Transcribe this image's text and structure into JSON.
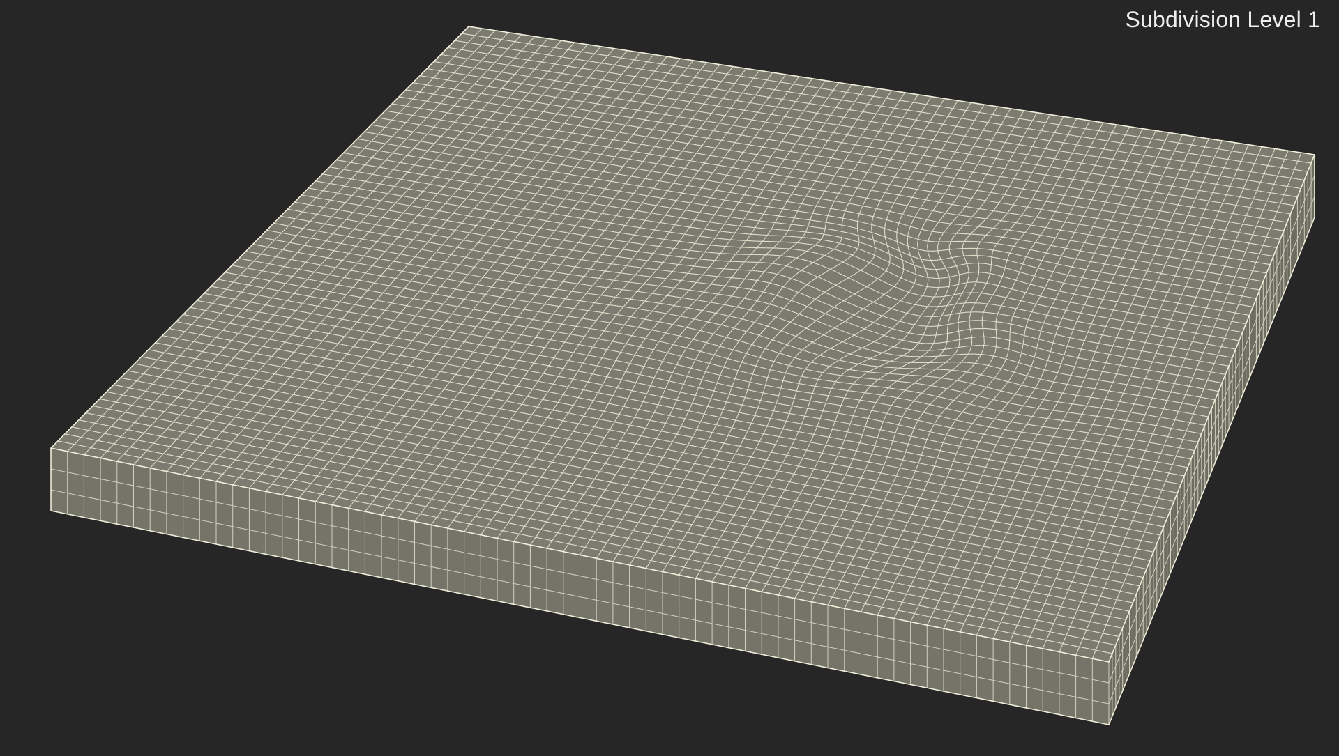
{
  "overlay": {
    "label": "Subdivision Level 1"
  },
  "colors": {
    "background": "#262626",
    "surface": "#7b7b6f",
    "side_left": "#747469",
    "side_right": "#6c6c61",
    "wire": "#f2f0dc",
    "label": "#eeeeee"
  },
  "mesh": {
    "rows": 60,
    "cols": 64,
    "side_rows": 3,
    "subdivision_level": 1
  }
}
